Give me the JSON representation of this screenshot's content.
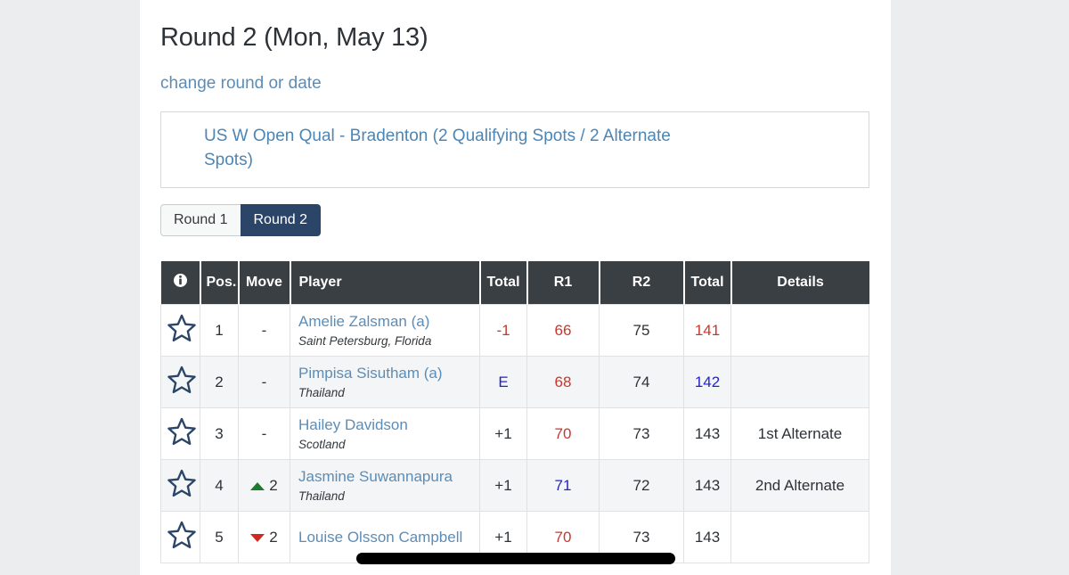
{
  "header": {
    "title": "Round 2 (Mon, May 13)",
    "change_link": "change round or date"
  },
  "event": {
    "name": "US W Open Qual - Bradenton (2 Qualifying Spots / 2 Alternate Spots)"
  },
  "round_tabs": [
    {
      "label": "Round 1",
      "active": false
    },
    {
      "label": "Round 2",
      "active": true
    }
  ],
  "table": {
    "columns": [
      {
        "key": "info",
        "label": "",
        "icon": "info-circle-icon"
      },
      {
        "key": "pos",
        "label": "Pos."
      },
      {
        "key": "move",
        "label": "Move"
      },
      {
        "key": "player",
        "label": "Player"
      },
      {
        "key": "total_to_par",
        "label": "Total"
      },
      {
        "key": "r1",
        "label": "R1"
      },
      {
        "key": "r2",
        "label": "R2"
      },
      {
        "key": "total_strokes",
        "label": "Total"
      },
      {
        "key": "details",
        "label": "Details"
      }
    ],
    "rows": [
      {
        "star": "star-outline-icon",
        "pos": "1",
        "move_dir": "none",
        "move_value": "-",
        "player": "Amelie Zalsman (a)",
        "location": "Saint Petersburg, Florida",
        "total_to_par": "-1",
        "total_to_par_color": "red",
        "r1": "66",
        "r1_color": "red",
        "r2": "75",
        "r2_color": "black",
        "total_strokes": "141",
        "total_strokes_color": "red",
        "details": ""
      },
      {
        "star": "star-outline-icon",
        "pos": "2",
        "move_dir": "none",
        "move_value": "-",
        "player": "Pimpisa Sisutham (a)",
        "location": "Thailand",
        "total_to_par": "E",
        "total_to_par_color": "blue",
        "r1": "68",
        "r1_color": "red",
        "r2": "74",
        "r2_color": "black",
        "total_strokes": "142",
        "total_strokes_color": "blue",
        "details": ""
      },
      {
        "star": "star-outline-icon",
        "pos": "3",
        "move_dir": "none",
        "move_value": "-",
        "player": "Hailey Davidson",
        "location": "Scotland",
        "total_to_par": "+1",
        "total_to_par_color": "black",
        "r1": "70",
        "r1_color": "red",
        "r2": "73",
        "r2_color": "black",
        "total_strokes": "143",
        "total_strokes_color": "black",
        "details": "1st Alternate"
      },
      {
        "star": "star-outline-icon",
        "pos": "4",
        "move_dir": "up",
        "move_value": "2",
        "player": "Jasmine Suwannapura",
        "location": "Thailand",
        "total_to_par": "+1",
        "total_to_par_color": "black",
        "r1": "71",
        "r1_color": "blue",
        "r2": "72",
        "r2_color": "black",
        "total_strokes": "143",
        "total_strokes_color": "black",
        "details": "2nd Alternate"
      },
      {
        "star": "star-outline-icon",
        "pos": "5",
        "move_dir": "down",
        "move_value": "2",
        "player": "Louise Olsson Campbell",
        "location": "",
        "total_to_par": "+1",
        "total_to_par_color": "black",
        "r1": "70",
        "r1_color": "red",
        "r2": "73",
        "r2_color": "black",
        "total_strokes": "143",
        "total_strokes_color": "black",
        "details": ""
      }
    ]
  },
  "colors": {
    "header_bg": "#3a3f44",
    "active_tab": "#2b4568",
    "link": "#5b8db8",
    "under_par": "#c9372c",
    "even_par": "#2222cc",
    "move_up": "#1e7b2e",
    "move_down": "#cf2a20",
    "page_bg": "#ebedee",
    "redaction": "#000000"
  }
}
